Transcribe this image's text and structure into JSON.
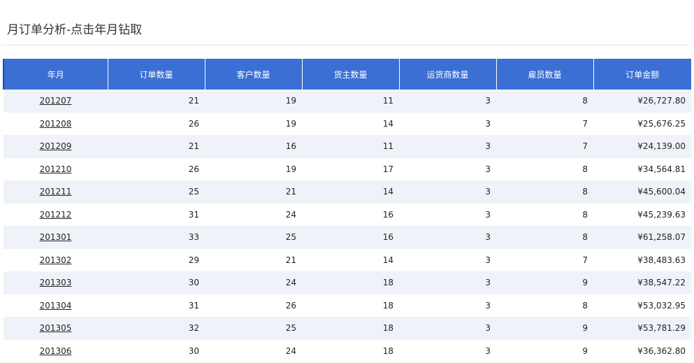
{
  "page_title": "月订单分析-点击年月钻取",
  "table": {
    "headers": [
      "年月",
      "订单数量",
      "客户数量",
      "货主数量",
      "运货商数量",
      "雇员数量",
      "订单金额"
    ],
    "rows": [
      [
        "201207",
        "21",
        "19",
        "11",
        "3",
        "8",
        "¥26,727.80"
      ],
      [
        "201208",
        "26",
        "19",
        "14",
        "3",
        "7",
        "¥25,676.25"
      ],
      [
        "201209",
        "21",
        "16",
        "11",
        "3",
        "7",
        "¥24,139.00"
      ],
      [
        "201210",
        "26",
        "19",
        "17",
        "3",
        "8",
        "¥34,564.81"
      ],
      [
        "201211",
        "25",
        "21",
        "14",
        "3",
        "8",
        "¥45,600.04"
      ],
      [
        "201212",
        "31",
        "24",
        "16",
        "3",
        "8",
        "¥45,239.63"
      ],
      [
        "201301",
        "33",
        "25",
        "16",
        "3",
        "8",
        "¥61,258.07"
      ],
      [
        "201302",
        "29",
        "21",
        "14",
        "3",
        "7",
        "¥38,483.63"
      ],
      [
        "201303",
        "30",
        "24",
        "18",
        "3",
        "9",
        "¥38,547.22"
      ],
      [
        "201304",
        "31",
        "26",
        "18",
        "3",
        "8",
        "¥53,032.95"
      ],
      [
        "201305",
        "32",
        "25",
        "18",
        "3",
        "9",
        "¥53,781.29"
      ],
      [
        "201306",
        "30",
        "24",
        "18",
        "3",
        "9",
        "¥36,362.80"
      ]
    ]
  },
  "colors": {
    "header_bg": "#3b6fd3",
    "row_stripe": "#eff3f9"
  }
}
